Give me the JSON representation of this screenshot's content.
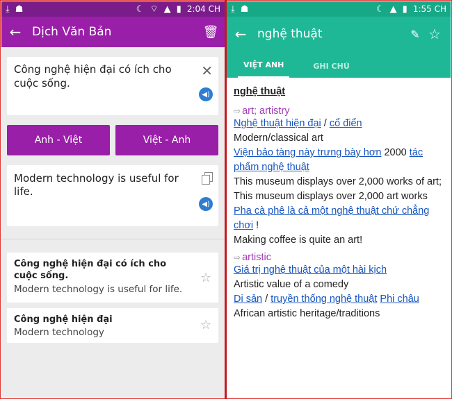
{
  "left": {
    "status": {
      "time": "2:04 CH"
    },
    "appbar": {
      "title": "Dịch Văn Bản"
    },
    "input": {
      "text": "Công nghệ hiện đại có ích cho cuộc sống."
    },
    "buttons": {
      "en_vi": "Anh - Việt",
      "vi_en": "Việt - Anh"
    },
    "output": {
      "text": "Modern technology is useful for life."
    },
    "history": [
      {
        "vi": "Công nghệ hiện đại có ích cho cuộc sống.",
        "en": "Modern technology is useful for life."
      },
      {
        "vi": "Công nghệ hiện đại",
        "en": "Modern technology"
      }
    ]
  },
  "right": {
    "status": {
      "time": "1:55 CH"
    },
    "appbar": {
      "title": "nghệ thuật"
    },
    "tabs": [
      {
        "label": "VIỆT ANH"
      },
      {
        "label": "GHI CHÚ"
      }
    ],
    "headword": "nghệ thuật",
    "pos1": "art; artistry",
    "ex1": {
      "vi_parts": [
        "Nghệ thuật hiện đại",
        " / ",
        "cổ điển"
      ],
      "en": "Modern/classical art"
    },
    "ex2": {
      "vi_a": "Viện bảo tàng này trưng bày hơn",
      "vi_b": " 2000 ",
      "vi_c": "tác phẩm nghệ thuật",
      "en": "This museum displays over 2,000 works of art; This museum displays over 2,000 art works"
    },
    "ex3": {
      "vi_a": "Pha cà phê là cả một nghệ thuật chứ chẳng chơi",
      "vi_b": " !",
      "en": "Making coffee is quite an art!"
    },
    "pos2": "artistic",
    "ex4": {
      "vi": "Giá trị nghệ thuật của một hài kịch",
      "en": "Artistic value of a comedy"
    },
    "ex5": {
      "vi_a": "Di sản",
      "vi_b": " / ",
      "vi_c": "truyền thống nghệ thuật",
      "vi_d": " ",
      "vi_e": "Phi châu",
      "en": "African artistic heritage/traditions"
    }
  }
}
